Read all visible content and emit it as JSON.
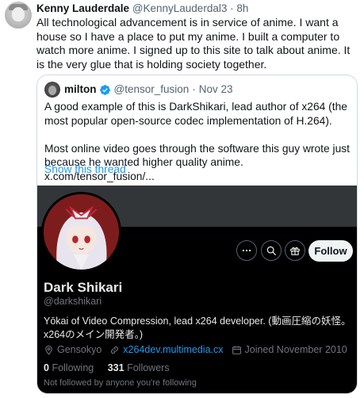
{
  "tweet": {
    "author_name": "Kenny Lauderdale",
    "author_handle": "@KennyLauderdal3",
    "separator": "·",
    "time": "8h",
    "text": "All technological advancement is in service of anime. I want a house so I have a place to put my anime. I built a computer to watch more anime. I signed up to this site to talk about anime. It is the very glue that is holding society together."
  },
  "quote": {
    "author_name": "milton",
    "author_handle": "@tensor_fusion",
    "separator": "·",
    "time": "Nov 23",
    "paragraph1": "A good example of this is DarkShikari, lead author of x264 (the most popular open-source codec implementation of H.264).",
    "paragraph2": "Most online video goes through the software this guy wrote just because he wanted higher quality anime.",
    "paragraph2_link": "x.com/tensor_fusion/...",
    "show_thread": "Show this thread"
  },
  "profile_card": {
    "name": "Dark Shikari",
    "handle": "@darkshikari",
    "bio": "Yōkai of Video Compression, lead x264 developer. (動画圧縮の妖怪。x264のメイン開発者。)",
    "location": "Gensokyo",
    "website": "x264dev.multimedia.cx",
    "joined": "Joined November 2010",
    "following_count": "0",
    "following_label": "Following",
    "followers_count": "331",
    "followers_label": "Followers",
    "not_followed": "Not followed by anyone you're following",
    "follow_label": "Follow"
  },
  "colors": {
    "accent": "#1d9bf0",
    "card_bg": "#000000",
    "banner": "#333639"
  },
  "icons": [
    "more-icon",
    "search-icon",
    "gift-icon",
    "location-icon",
    "link-icon",
    "calendar-icon",
    "verified-icon"
  ]
}
